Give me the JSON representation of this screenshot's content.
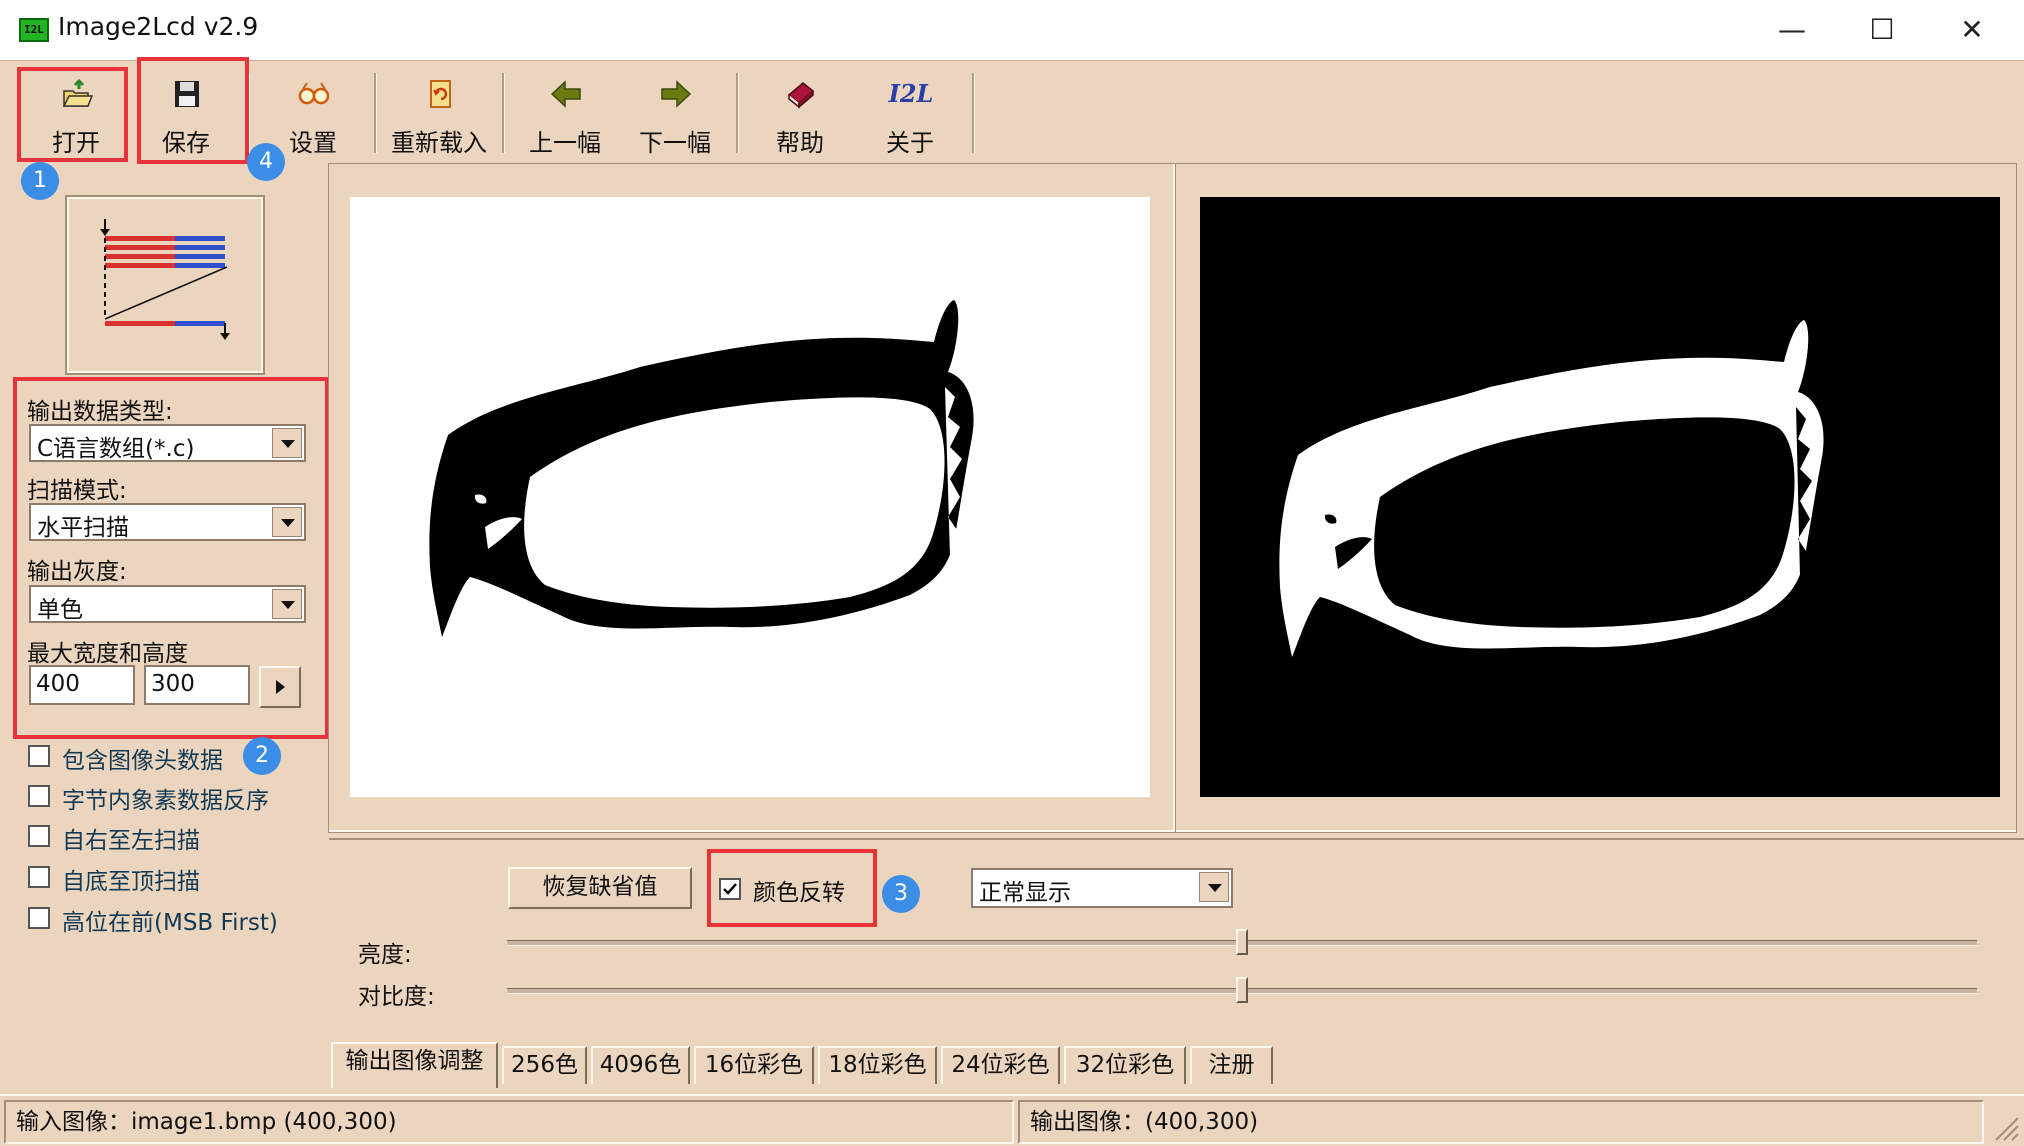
{
  "window": {
    "title": "Image2Lcd v2.9",
    "app_icon_text": "I2L",
    "controls": {
      "minimize": "—",
      "maximize": "☐",
      "close": "✕"
    }
  },
  "toolbar": {
    "open": "打开",
    "save": "保存",
    "settings": "设置",
    "reload": "重新载入",
    "prev": "上一幅",
    "next": "下一幅",
    "help": "帮助",
    "about": "关于",
    "about_icon_text": "I2L"
  },
  "annotations": {
    "b1": "1",
    "b2": "2",
    "b3": "3",
    "b4": "4"
  },
  "left_panel": {
    "output_type_label": "输出数据类型:",
    "output_type_value": "C语言数组(*.c)",
    "scan_mode_label": "扫描模式:",
    "scan_mode_value": "水平扫描",
    "gray_label": "输出灰度:",
    "gray_value": "单色",
    "max_size_label": "最大宽度和高度",
    "max_width": "400",
    "max_height": "300",
    "options": [
      {
        "label": "包含图像头数据",
        "checked": false
      },
      {
        "label": "字节内象素数据反序",
        "checked": false
      },
      {
        "label": "自右至左扫描",
        "checked": false
      },
      {
        "label": "自底至顶扫描",
        "checked": false
      },
      {
        "label": "高位在前(MSB First)",
        "checked": false
      }
    ]
  },
  "adjust": {
    "restore_default": "恢复缺省值",
    "invert_label": "颜色反转",
    "invert_checked": true,
    "display_mode": "正常显示",
    "brightness_label": "亮度:",
    "contrast_label": "对比度:",
    "brightness_value": 0.5,
    "contrast_value": 0.5
  },
  "tabs": [
    "输出图像调整",
    "256色",
    "4096色",
    "16位彩色",
    "18位彩色",
    "24位彩色",
    "32位彩色",
    "注册"
  ],
  "status": {
    "input": "输入图像：image1.bmp (400,300)",
    "output": "输出图像：(400,300)"
  },
  "colors": {
    "window_bg": "#ecd5bf",
    "annotation_red": "#e8323c",
    "badge_blue": "#3c8de6"
  }
}
